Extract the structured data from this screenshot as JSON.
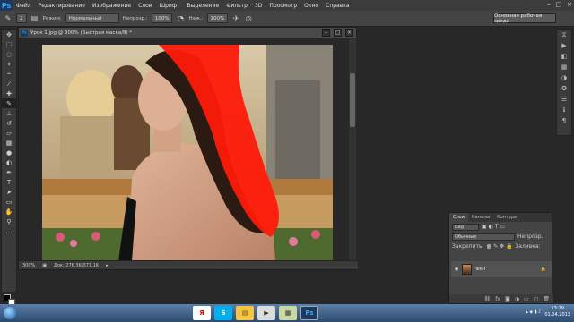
{
  "menubar": {
    "app_logo": "Ps",
    "items": [
      "Файл",
      "Редактирование",
      "Изображение",
      "Слои",
      "Шрифт",
      "Выделение",
      "Фильтр",
      "3D",
      "Просмотр",
      "Окно",
      "Справка"
    ],
    "min": "–",
    "restore": "□",
    "close": "×"
  },
  "options": {
    "brush_size": "2",
    "mode_label": "Режим:",
    "mode_value": "Нормальный",
    "opacity_label": "Непрозр.:",
    "opacity_value": "100%",
    "pressure_label": "Наж.:",
    "pressure_value": "100%",
    "workspace": "Основная рабочая среда"
  },
  "document": {
    "tab": "Урок 1.jpg @ 300% (Быстрая маска/8) *",
    "zoom": "300%",
    "doc_info": "Док: 276,3K/371,1K"
  },
  "layers_panel": {
    "tabs": [
      "Слои",
      "Каналы",
      "Контуры"
    ],
    "kind": "Вид",
    "blend": "Обычные",
    "opacity_label": "Непрозр.:",
    "lock_label": "Закрепить:",
    "fill_label": "Заливка:",
    "layer_name": "Фон"
  },
  "taskbar": {
    "time": "13:29",
    "date": "01.04.2013"
  },
  "colors": {
    "mask_red": "#ff1a0a",
    "panel": "#444444",
    "workspace_bg": "#282828"
  }
}
